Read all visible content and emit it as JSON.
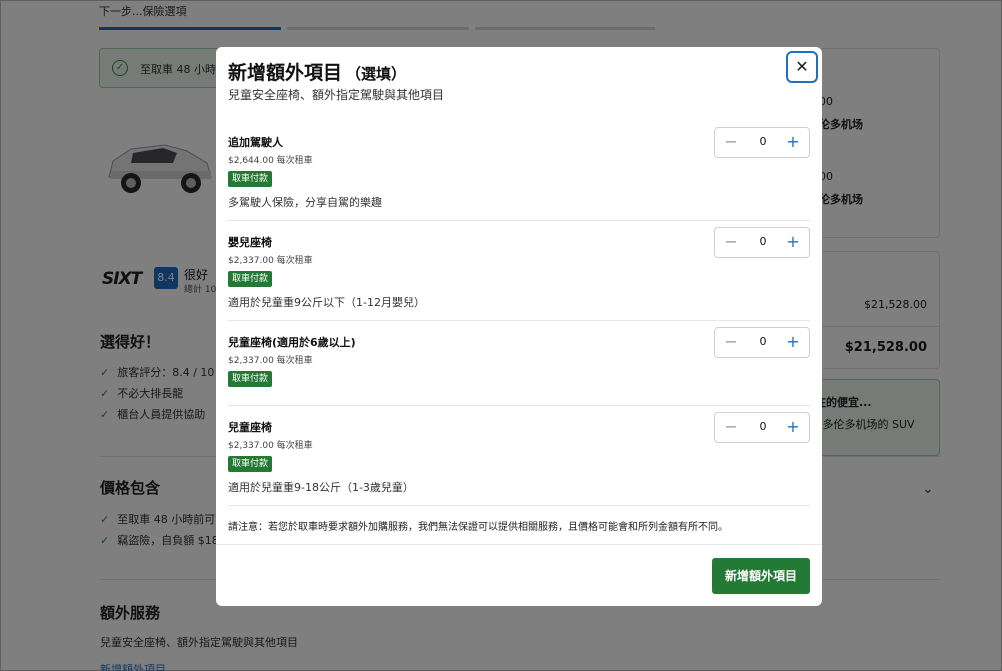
{
  "background": {
    "progress_label": "下一步...保險選項",
    "notice": "至取車 48 小時前",
    "right_card_lines": [
      "00",
      "伦多机场",
      "00",
      "伦多机场"
    ],
    "price_total_small": "$21,528.00",
    "price_total_big": "$21,528.00",
    "deal_lines": [
      "在的便宜...",
      "- 多伦多机场的 SUV"
    ],
    "brand": "SIXT",
    "rating_score": "8.4",
    "rating_word": "很好",
    "rating_count": "總計 10",
    "good_choice_title": "選得好！",
    "good_choice_items": [
      "旅客評分：8.4 / 10",
      "不必大排長龍",
      "櫃台人員提供協助"
    ],
    "price_includes_title": "價格包含",
    "price_includes_items": [
      "至取車 48 小時前可",
      "竊盜險，自負額 $18,"
    ],
    "extras_title": "額外服務",
    "extras_subtitle": "兒童安全座椅、額外指定駕駛與其他項目",
    "extras_link": "新增額外項目",
    "colors": {
      "accent": "#1f6fc4",
      "green": "#237a35"
    }
  },
  "modal": {
    "title": "新增額外項目",
    "title_optional": "（選填）",
    "subtitle": "兒童安全座椅、額外指定駕駛與其他項目",
    "close_icon": "close-icon",
    "items": [
      {
        "name": "追加駕駛人",
        "price": "$2,644.00 每次租車",
        "badge": "取車付款",
        "desc": "多駕駛人保險，分享自駕的樂趣",
        "qty": "0"
      },
      {
        "name": "嬰兒座椅",
        "price": "$2,337.00 每次租車",
        "badge": "取車付款",
        "desc": "適用於兒童重9公斤以下（1-12月嬰兒）",
        "qty": "0"
      },
      {
        "name": "兒童座椅(適用於6歲以上)",
        "price": "$2,337.00 每次租車",
        "badge": "取車付款",
        "desc": "",
        "qty": "0"
      },
      {
        "name": "兒童座椅",
        "price": "$2,337.00 每次租車",
        "badge": "取車付款",
        "desc": "適用於兒童重9-18公斤（1-3歲兒童）",
        "qty": "0"
      }
    ],
    "note": "請注意：若您於取車時要求額外加購服務，我們無法保證可以提供相關服務，且價格可能會和所列金額有所不同。",
    "add_button": "新增額外項目"
  }
}
